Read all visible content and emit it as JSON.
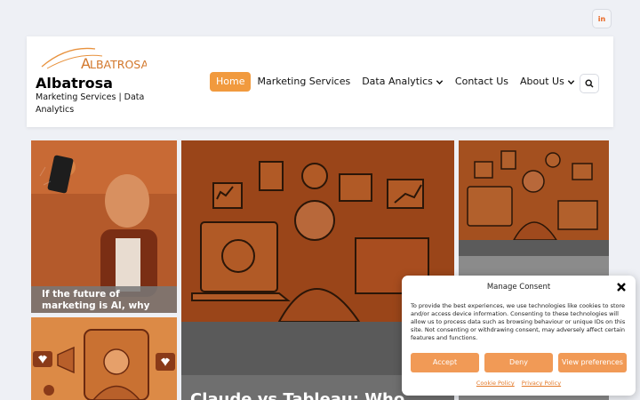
{
  "topbar": {
    "social_icon": "linkedin-icon",
    "social_label": "in"
  },
  "brand": {
    "logo_text": "LBATROSA",
    "logo_initial": "A",
    "site_title": "Albatrosa",
    "tagline": "Marketing Services | Data Analytics"
  },
  "nav": {
    "items": [
      {
        "label": "Home",
        "active": true,
        "dropdown": false
      },
      {
        "label": "Marketing Services",
        "active": false,
        "dropdown": false
      },
      {
        "label": "Data Analytics",
        "active": false,
        "dropdown": true
      },
      {
        "label": "Contact Us",
        "active": false,
        "dropdown": false
      },
      {
        "label": "About Us",
        "active": false,
        "dropdown": true
      }
    ],
    "search_icon": "search-icon"
  },
  "posts": [
    {
      "title": "If the future of marketing is AI, why is..."
    },
    {
      "title": "Claude vs Tableau: Who"
    }
  ],
  "consent": {
    "title": "Manage Consent",
    "body": "To provide the best experiences, we use technologies like cookies to store and/or access device information. Consenting to these technologies will allow us to process data such as browsing behaviour or unique IDs on this site. Not consenting or withdrawing consent, may adversely affect certain features and functions.",
    "accept": "Accept",
    "deny": "Deny",
    "preferences": "View preferences",
    "cookie_policy": "Cookie Policy",
    "privacy_policy": "Privacy Policy"
  },
  "colors": {
    "accent": "#f19a3e",
    "button": "#f19a56",
    "link": "#e37a2a"
  }
}
